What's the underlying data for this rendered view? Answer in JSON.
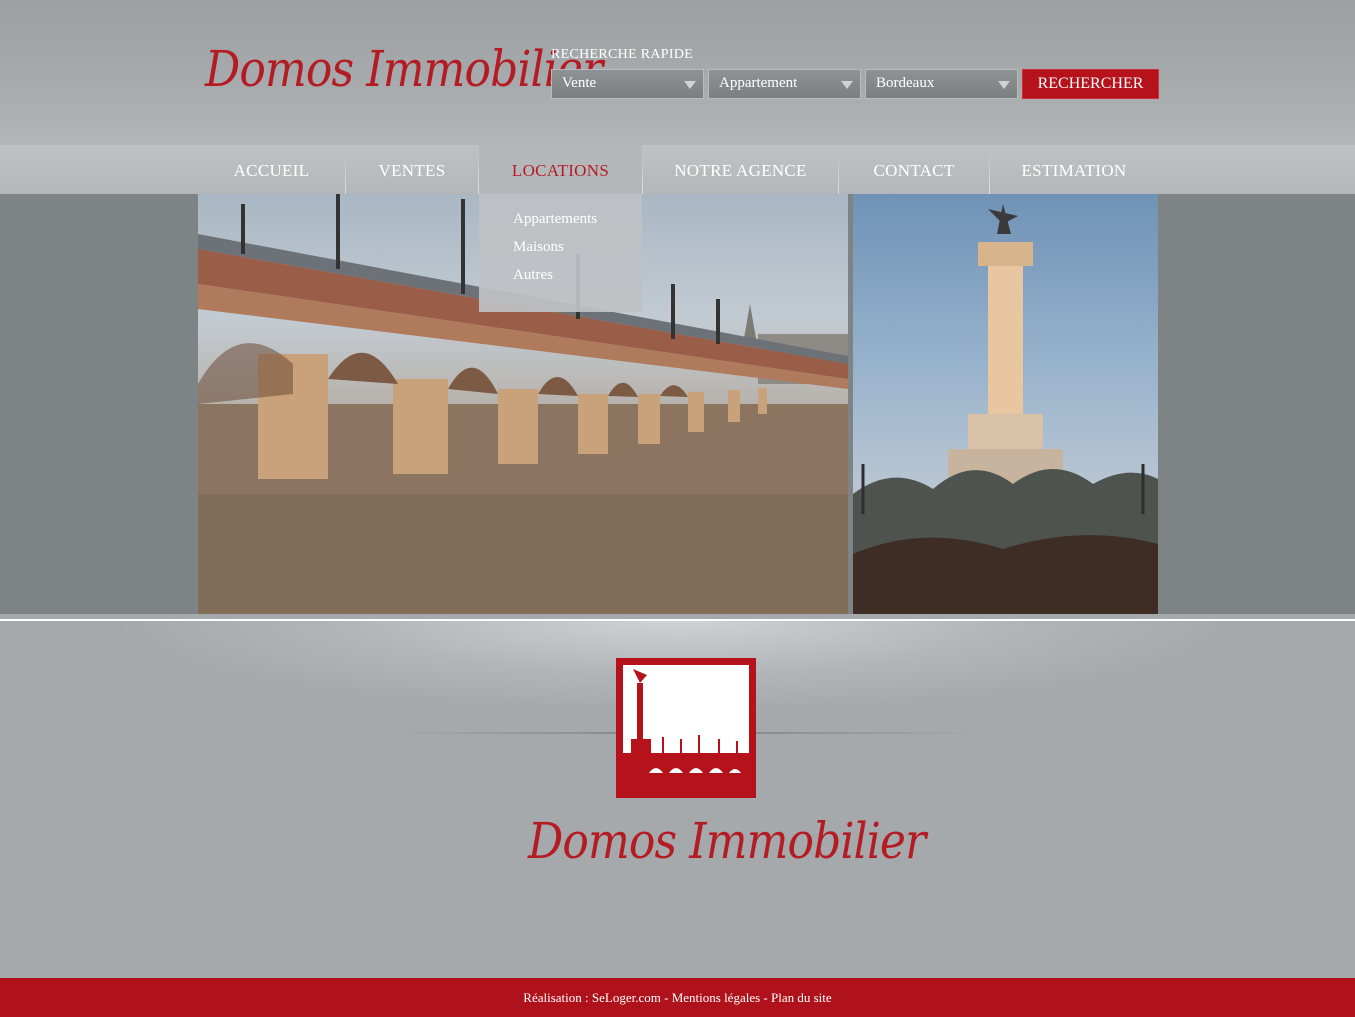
{
  "brand": {
    "name": "Domos Immobilier",
    "accent_color": "#b41c24"
  },
  "search": {
    "title": "RECHERCHE RAPIDE",
    "transaction": "Vente",
    "property_type": "Appartement",
    "city": "Bordeaux",
    "button_label": "RECHERCHER"
  },
  "nav": {
    "items": [
      {
        "label": "ACCUEIL"
      },
      {
        "label": "VENTES"
      },
      {
        "label": "LOCATIONS",
        "active": true
      },
      {
        "label": "NOTRE AGENCE"
      },
      {
        "label": "CONTACT"
      },
      {
        "label": "ESTIMATION"
      }
    ],
    "dropdown": [
      "Appartements",
      "Maisons",
      "Autres"
    ]
  },
  "photos": {
    "left_icon": "bridge-photo",
    "right_icon": "monument-photo"
  },
  "bottom_logo": {
    "name": "Domos Immobilier",
    "emblem_icon": "bordeaux-emblem-icon"
  },
  "footer": {
    "realisation": "Réalisation : SeLoger.com",
    "separator": " - ",
    "legal": "Mentions légales",
    "sitemap": "Plan du site"
  }
}
